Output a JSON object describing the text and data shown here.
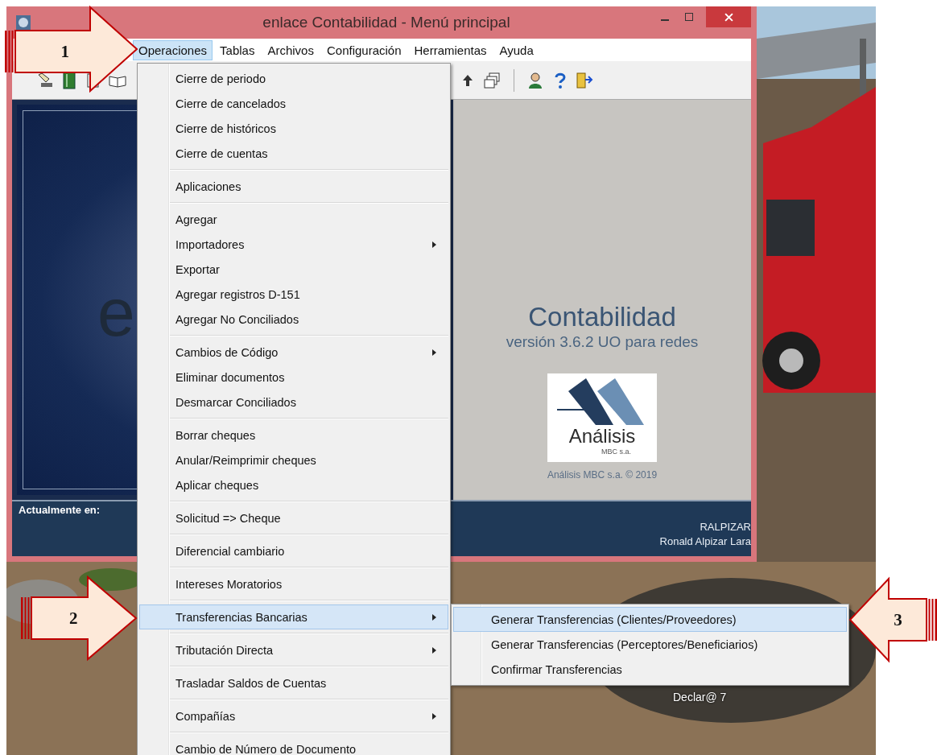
{
  "window": {
    "title": "enlace Contabilidad - Menú principal"
  },
  "menu_bar": [
    {
      "label": "Operaciones",
      "selected": true
    },
    {
      "label": "Tablas",
      "selected": false
    },
    {
      "label": "Archivos",
      "selected": false
    },
    {
      "label": "Configuración",
      "selected": false
    },
    {
      "label": "Herramientas",
      "selected": false
    },
    {
      "label": "Ayuda",
      "selected": false
    }
  ],
  "dropdown": {
    "groups": [
      {
        "items": [
          {
            "label": "Cierre de periodo",
            "submenu": false,
            "selected": false
          },
          {
            "label": "Cierre de cancelados",
            "submenu": false,
            "selected": false
          },
          {
            "label": "Cierre de históricos",
            "submenu": false,
            "selected": false
          },
          {
            "label": "Cierre de cuentas",
            "submenu": false,
            "selected": false
          }
        ]
      },
      {
        "items": [
          {
            "label": "Aplicaciones",
            "submenu": false,
            "selected": false
          }
        ]
      },
      {
        "items": [
          {
            "label": "Agregar",
            "submenu": false,
            "selected": false
          },
          {
            "label": "Importadores",
            "submenu": true,
            "selected": false
          },
          {
            "label": "Exportar",
            "submenu": false,
            "selected": false
          },
          {
            "label": "Agregar registros D-151",
            "submenu": false,
            "selected": false
          },
          {
            "label": "Agregar No Conciliados",
            "submenu": false,
            "selected": false
          }
        ]
      },
      {
        "items": [
          {
            "label": "Cambios de Código",
            "submenu": true,
            "selected": false
          },
          {
            "label": "Eliminar documentos",
            "submenu": false,
            "selected": false
          },
          {
            "label": "Desmarcar Conciliados",
            "submenu": false,
            "selected": false
          }
        ]
      },
      {
        "items": [
          {
            "label": "Borrar cheques",
            "submenu": false,
            "selected": false
          },
          {
            "label": "Anular/Reimprimir cheques",
            "submenu": false,
            "selected": false
          },
          {
            "label": "Aplicar cheques",
            "submenu": false,
            "selected": false
          }
        ]
      },
      {
        "items": [
          {
            "label": "Solicitud => Cheque",
            "submenu": false,
            "selected": false
          }
        ]
      },
      {
        "items": [
          {
            "label": "Diferencial cambiario",
            "submenu": false,
            "selected": false
          }
        ]
      },
      {
        "items": [
          {
            "label": "Intereses Moratorios",
            "submenu": false,
            "selected": false
          }
        ]
      },
      {
        "items": [
          {
            "label": "Transferencias Bancarias",
            "submenu": true,
            "selected": true
          }
        ]
      },
      {
        "items": [
          {
            "label": "Tributación Directa",
            "submenu": true,
            "selected": false
          }
        ]
      },
      {
        "items": [
          {
            "label": "Trasladar Saldos de Cuentas",
            "submenu": false,
            "selected": false
          }
        ]
      },
      {
        "items": [
          {
            "label": "Compañías",
            "submenu": true,
            "selected": false
          }
        ]
      },
      {
        "items": [
          {
            "label": "Cambio de Número de Documento",
            "submenu": false,
            "selected": false
          }
        ]
      }
    ]
  },
  "submenu": {
    "items": [
      {
        "label": "Generar Transferencias (Clientes/Proveedores)",
        "selected": true
      },
      {
        "label": "Generar Transferencias (Perceptores/Beneficiarios)",
        "selected": false
      },
      {
        "label": "Confirmar Transferencias",
        "selected": false
      }
    ]
  },
  "splash": {
    "letter": "e",
    "product": "Contabilidad",
    "version": "versión 3.6.2 UO para redes",
    "logo_text": "Análisis",
    "logo_subtext": "MBC s.a.",
    "copyright": "Análisis MBC s.a. © 2019"
  },
  "status": {
    "label": "Actualmente en:",
    "user_id": "RALPIZAR",
    "user_name": "Ronald Alpizar Lara"
  },
  "desktop": {
    "icon_label": "Declar@ 7"
  },
  "callouts": [
    {
      "number": "1",
      "kind": "right"
    },
    {
      "number": "2",
      "kind": "right"
    },
    {
      "number": "3",
      "kind": "left"
    }
  ]
}
